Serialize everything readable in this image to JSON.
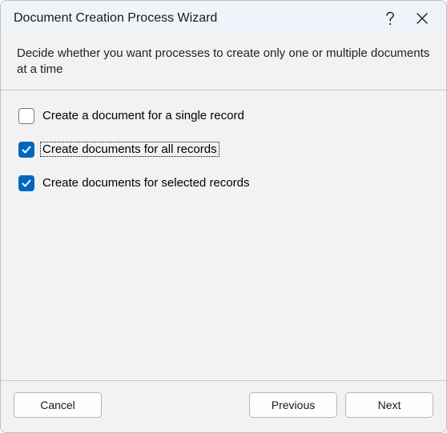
{
  "titlebar": {
    "title": "Document Creation Process Wizard"
  },
  "instructions": "Decide whether you want processes to create only one or multiple documents at a time",
  "options": [
    {
      "label": "Create a document for a single record",
      "checked": false,
      "focused": false
    },
    {
      "label": "Create documents for all records",
      "checked": true,
      "focused": true
    },
    {
      "label": "Create documents for selected records",
      "checked": true,
      "focused": false
    }
  ],
  "buttons": {
    "cancel": "Cancel",
    "previous": "Previous",
    "next": "Next"
  }
}
